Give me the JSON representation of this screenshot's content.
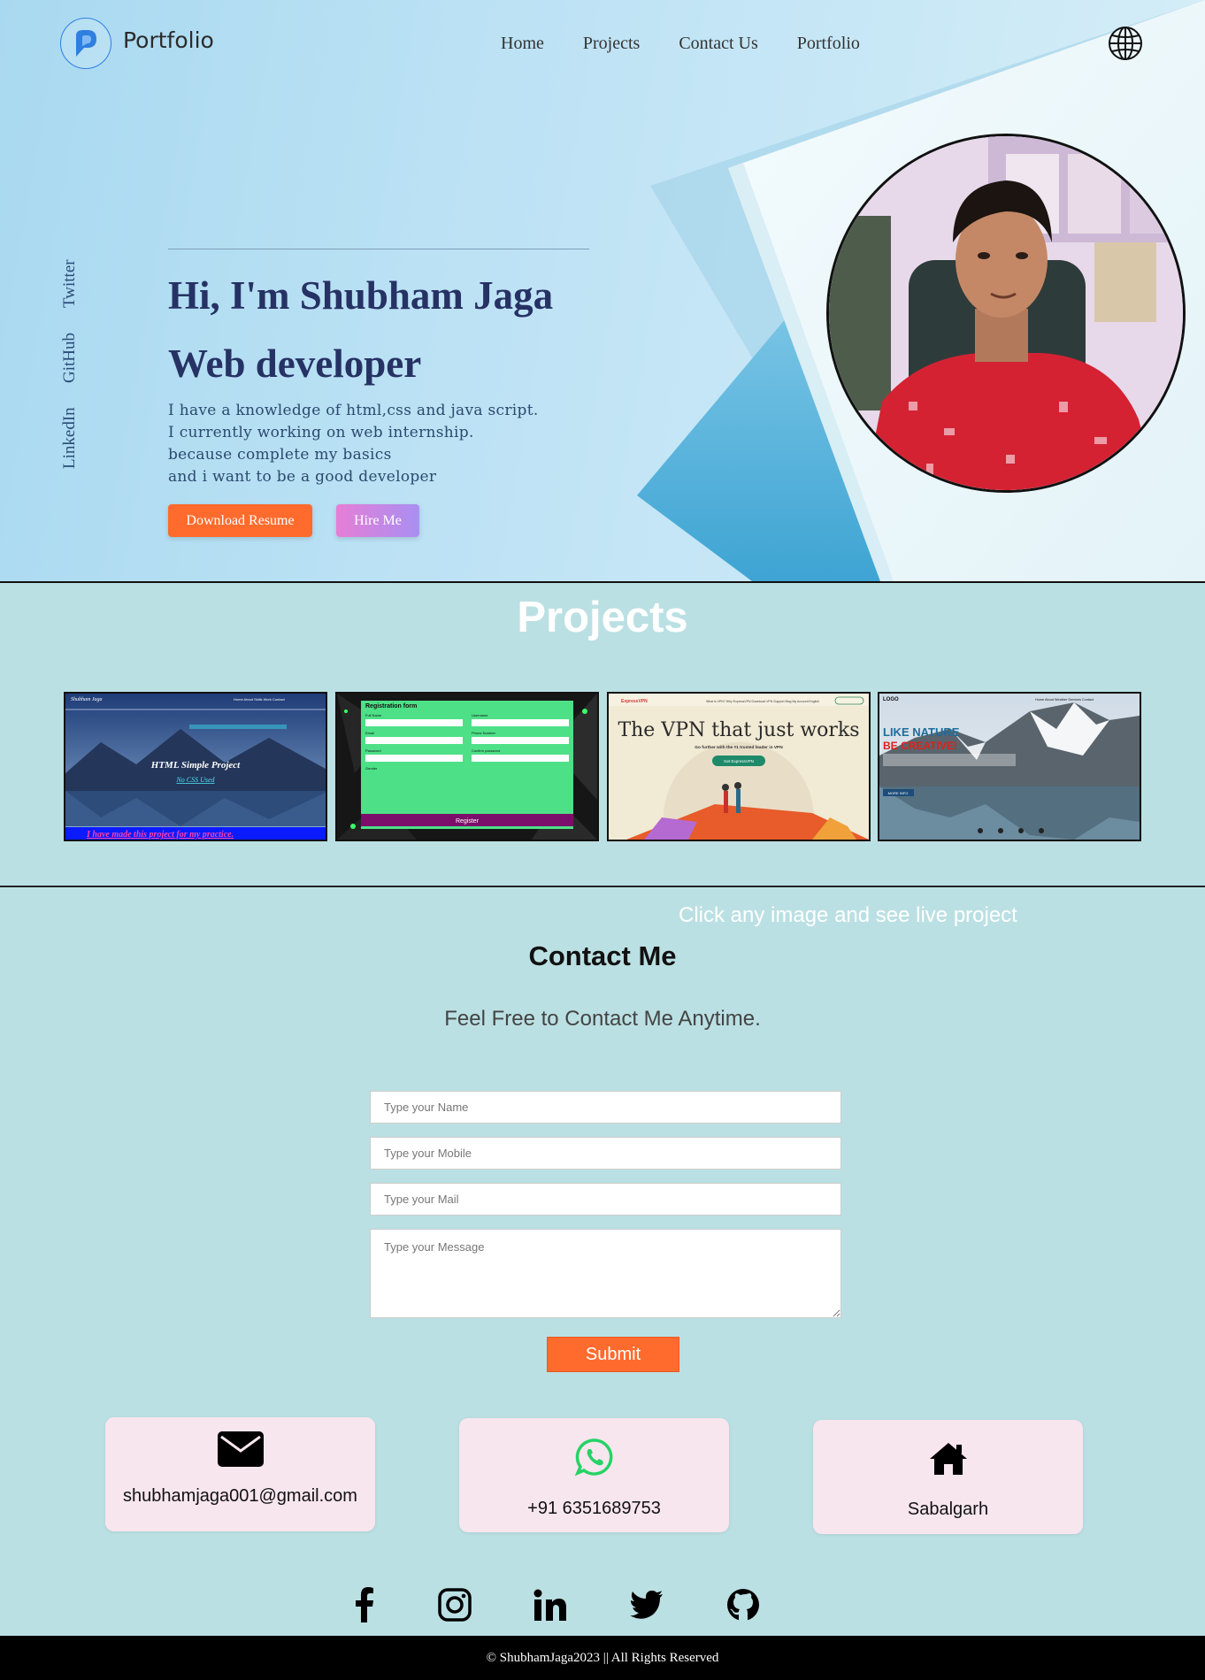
{
  "header": {
    "logo_text": "Portfolio",
    "nav": [
      "Home",
      "Projects",
      "Contact Us",
      "Portfolio"
    ]
  },
  "side_socials": [
    "Twitter",
    "GitHub",
    "LinkedIn"
  ],
  "hero": {
    "title": "Hi, I'm Shubham Jaga",
    "subtitle": "Web developer",
    "description": [
      "I have a knowledge of html,css and java script.",
      "I currently working on web internship.",
      "because complete my basics",
      "and i want to be a good developer"
    ],
    "download_label": "Download Resume",
    "hire_label": "Hire Me"
  },
  "projects": {
    "title": "Projects",
    "note": "Click any image and see live project",
    "items": [
      {
        "heading": "HTML Simple Project",
        "sub": "No CSS Used",
        "footer": "I have made this project for my practice.",
        "logo": "Shubham Jaga"
      },
      {
        "heading": "Registration form",
        "button": "Register"
      },
      {
        "heading": "The VPN that just works",
        "sub": "Go further with the #1 trusted leader in VPN",
        "button": "Get ExpressVPN",
        "logo": "ExpressVPN"
      },
      {
        "heading": "LIKE NATURE",
        "sub": "BE CREATIVE!",
        "logo": "LOGO",
        "button": "MORE INFO"
      }
    ]
  },
  "contact": {
    "title": "Contact Me",
    "subtitle": "Feel Free to Contact Me Anytime.",
    "placeholders": {
      "name": "Type your Name",
      "mobile": "Type your Mobile",
      "mail": "Type your Mail",
      "message": "Type your Message"
    },
    "submit_label": "Submit",
    "cards": {
      "email": "shubhamjaga001@gmail.com",
      "phone": "+91 6351689753",
      "address": "Sabalgarh"
    }
  },
  "footer": {
    "text": "© ShubhamJaga2023 || All Rights Reserved"
  },
  "colors": {
    "accent": "#ff6b2d",
    "title_navy": "#263264",
    "section_bg": "#bbe0e3",
    "card_bg": "#f8e6ee",
    "whatsapp": "#25d366"
  }
}
